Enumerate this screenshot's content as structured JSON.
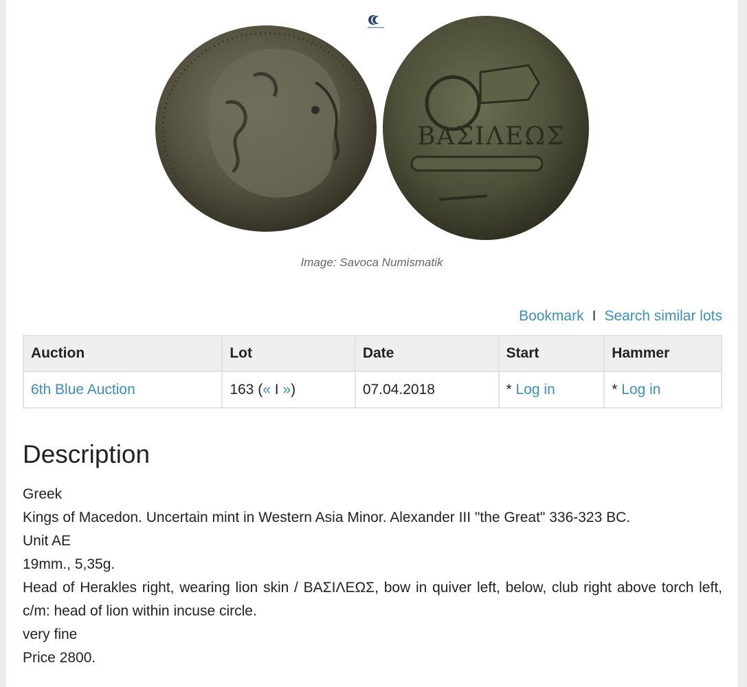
{
  "image": {
    "caption": "Image: Savoca Numismatik",
    "obverse_icon": "coin-obverse-herakles",
    "reverse_icon": "coin-reverse-basileos",
    "reverse_inscription": "ΒΑΣΙΛΕΩΣ"
  },
  "actions": {
    "bookmark": "Bookmark",
    "separator": "I",
    "search_similar": "Search similar lots"
  },
  "table": {
    "headers": [
      "Auction",
      "Lot",
      "Date",
      "Start",
      "Hammer"
    ],
    "row": {
      "auction": "6th Blue Auction",
      "lot_number": "163",
      "lot_prev": "«",
      "lot_sep": "I",
      "lot_next": "»",
      "date": "07.04.2018",
      "start_prefix": "* ",
      "start_link": "Log in",
      "hammer_prefix": "* ",
      "hammer_link": "Log in"
    }
  },
  "description": {
    "title": "Description",
    "lines": [
      "Greek",
      "Kings of Macedon. Uncertain mint in Western Asia Minor. Alexander III \"the Great\" 336-323 BC.",
      "Unit AE",
      "19mm., 5,35g.",
      "Head of Herakles right, wearing lion skin / ΒΑΣΙΛΕΩΣ, bow in quiver left, below, club right above torch left, c/m: head of lion within incuse circle.",
      "very fine",
      "Price 2800."
    ]
  },
  "colors": {
    "link": "#3a8ec0",
    "header_bg": "#efefef",
    "page_bg": "#ececec"
  }
}
